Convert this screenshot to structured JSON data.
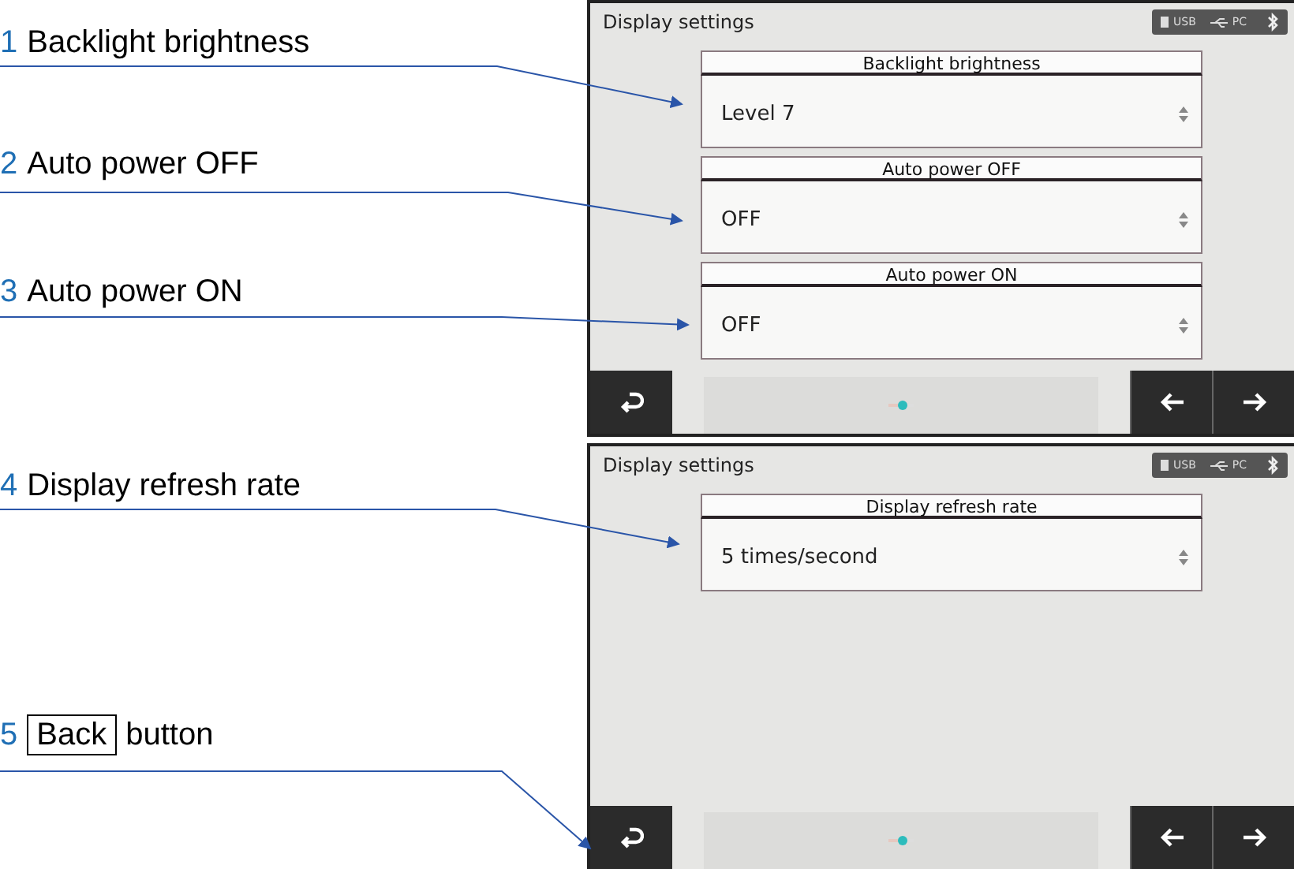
{
  "callouts": [
    {
      "kind": "plain",
      "number": "1",
      "text": "Backlight brightness"
    },
    {
      "kind": "plain",
      "number": "2",
      "text": "Auto power OFF"
    },
    {
      "kind": "plain",
      "number": "3",
      "text": "Auto power ON"
    },
    {
      "kind": "plain",
      "number": "4",
      "text": "Display refresh rate"
    },
    {
      "kind": "key",
      "number": "5",
      "key": "Back",
      "text": "button"
    }
  ],
  "screens": [
    {
      "title": "Display settings",
      "status": [
        "USB",
        "PC"
      ],
      "fields": [
        {
          "label": "Backlight brightness",
          "value": "Level 7"
        },
        {
          "label": "Auto power OFF",
          "value": "OFF"
        },
        {
          "label": "Auto power ON",
          "value": "OFF"
        }
      ]
    },
    {
      "title": "Display settings",
      "status": [
        "USB",
        "PC"
      ],
      "fields": [
        {
          "label": "Display refresh rate",
          "value": "5 times/second"
        }
      ]
    }
  ]
}
